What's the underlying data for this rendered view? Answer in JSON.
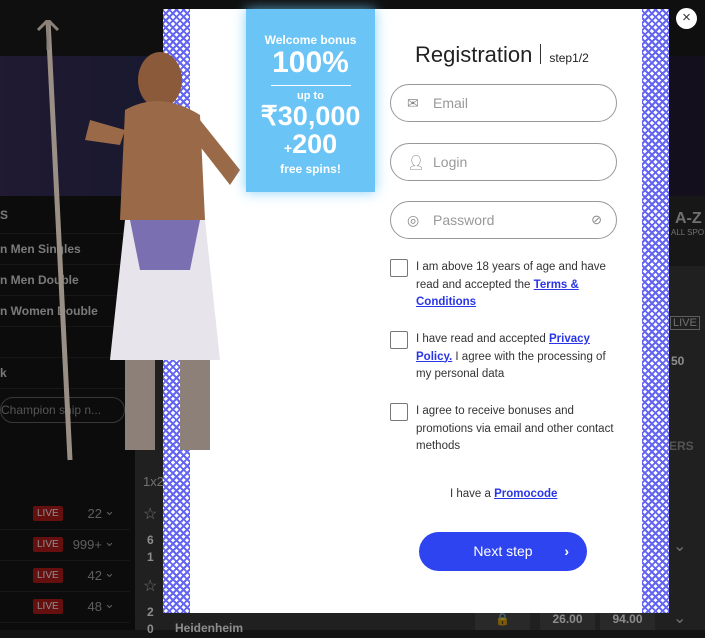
{
  "background": {
    "sidebar": {
      "heading": "S",
      "items": [
        "n Men Singles",
        "n Men Double",
        "n Women Double",
        "",
        "k"
      ],
      "search_placeholder": "Champion ship n..."
    },
    "live_rows": [
      {
        "badge": "LIVE",
        "count": "22"
      },
      {
        "badge": "LIVE",
        "count": "999+"
      },
      {
        "badge": "LIVE",
        "count": "42"
      },
      {
        "badge": "LIVE",
        "count": "48"
      }
    ],
    "market_label": "1x2",
    "az_label": "A-Z",
    "all_sports": "ALL SPO",
    "live_tag": "LIVE",
    "odd_partial": "50",
    "tab_partial": "ERS",
    "score1": [
      "6",
      "1"
    ],
    "score2": [
      "2",
      "0"
    ],
    "team_partial": "Heidenheim",
    "odds": [
      "26.00",
      "94.00"
    ]
  },
  "bonus": {
    "line1": "Welcome bonus",
    "line2": "100%",
    "line3": "up to",
    "line4": "₹30,000",
    "plus": "+",
    "line5": "200",
    "line6": "free spins!",
    "color": "#6ac4f5"
  },
  "form": {
    "title": "Registration",
    "step": "step1/2",
    "email_placeholder": "Email",
    "login_placeholder": "Login",
    "password_placeholder": "Password",
    "check1_text": "I am above 18 years of age and have read and accepted the ",
    "check1_link": "Terms & Conditions",
    "check2_text": "I have read and accepted ",
    "check2_link": "Privacy Policy.",
    "check2_tail": " I agree with the processing of my personal data",
    "check3_text": "I agree to receive bonuses and promotions via email and other contact methods",
    "promo_text": "I have a ",
    "promo_link": "Promocode",
    "next_label": "Next step",
    "next_arrow": "›",
    "accent": "#2d44f0"
  },
  "close_icon": "×"
}
